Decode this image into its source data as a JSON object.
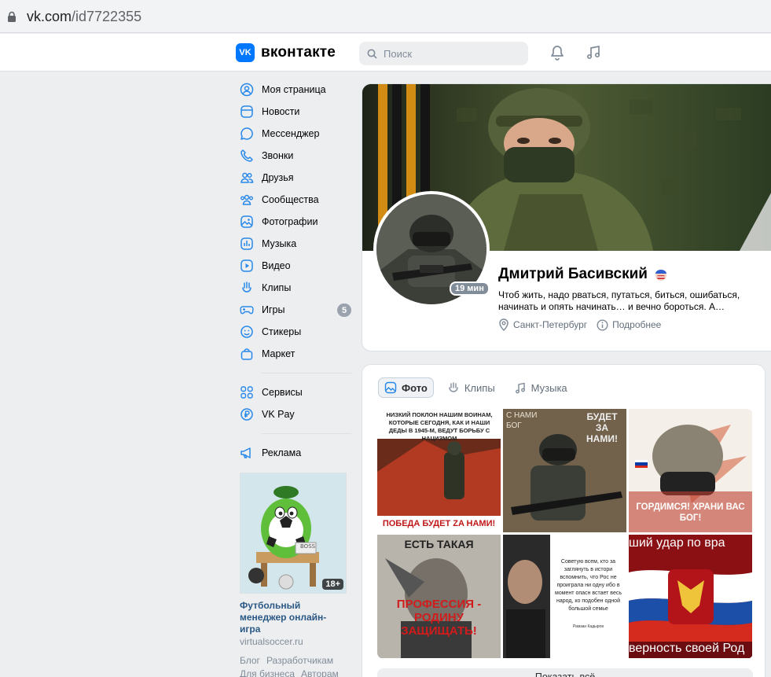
{
  "browser": {
    "url_host": "vk.com",
    "url_path": "/id7722355"
  },
  "header": {
    "logo_mark": "VK",
    "logo_text": "вконтакте",
    "search_placeholder": "Поиск"
  },
  "nav": {
    "items": [
      {
        "label": "Моя страница",
        "icon": "user-circle-icon"
      },
      {
        "label": "Новости",
        "icon": "newspaper-icon"
      },
      {
        "label": "Мессенджер",
        "icon": "message-icon"
      },
      {
        "label": "Звонки",
        "icon": "phone-icon"
      },
      {
        "label": "Друзья",
        "icon": "friends-icon"
      },
      {
        "label": "Сообщества",
        "icon": "communities-icon"
      },
      {
        "label": "Фотографии",
        "icon": "photo-icon"
      },
      {
        "label": "Музыка",
        "icon": "music-icon"
      },
      {
        "label": "Видео",
        "icon": "video-icon"
      },
      {
        "label": "Клипы",
        "icon": "clips-icon"
      },
      {
        "label": "Игры",
        "icon": "gamepad-icon",
        "badge": "5"
      },
      {
        "label": "Стикеры",
        "icon": "sticker-icon"
      },
      {
        "label": "Маркет",
        "icon": "market-icon"
      }
    ],
    "items2": [
      {
        "label": "Сервисы",
        "icon": "services-icon"
      },
      {
        "label": "VK Pay",
        "icon": "vkpay-icon"
      }
    ],
    "items3": [
      {
        "label": "Реклама",
        "icon": "megaphone-icon"
      }
    ]
  },
  "ad": {
    "title": "Футбольный менеджер онлайн-игра",
    "domain": "virtualsoccer.ru",
    "age": "18+",
    "board_text": "BOSS"
  },
  "footer": {
    "links": [
      "Блог",
      "Разработчикам",
      "Для бизнеса",
      "Авторам"
    ]
  },
  "profile": {
    "name": "Дмитрий Басивский",
    "status": "Чтоб жить, надо рваться, путаться, биться, ошибаться, начинать и опять начинать… и вечно бороться. А…",
    "city": "Санкт-Петербург",
    "more": "Подробнее",
    "online": "19 мин"
  },
  "media": {
    "tabs": [
      {
        "label": "Фото",
        "active": true
      },
      {
        "label": "Клипы",
        "active": false
      },
      {
        "label": "Музыка",
        "active": false
      }
    ],
    "show_all": "Показать всё",
    "photo_texts": {
      "p1_top": "НИЗКИЙ ПОКЛОН НАШИМ ВОИНАМ, КОТОРЫЕ СЕГОДНЯ, КАК И НАШИ ДЕДЫ В 1945-М, ВЕДУТ БОРЬБУ С НАЦИЗМОМ",
      "p1_bottom": "ПОБЕДА БУДЕТ ZA НАМИ!",
      "p2_text1": "С НАМИ",
      "p2_text2": "БОГ",
      "p2_text3": "БУДЕТ ЗА НАМИ!",
      "p3_text": "ГОРДИМСЯ! ХРАНИ ВАС БОГ!",
      "p4_top": "ЕСТЬ ТАКАЯ",
      "p4_bottom": "ПРОФЕССИЯ - РОДИНУ ЗАЩИЩАТЬ!",
      "p5_text": "Советую всем, кто за заглянуть в истори вспомнить, что Рос не проиграла ни одну ибо в момент опасн встает весь народ, ко подобен одной большой семье",
      "p5_sign": "Рамзан Кадыров",
      "p6_top": "ший удар по вра",
      "p6_bottom": "верность своей Род"
    }
  }
}
